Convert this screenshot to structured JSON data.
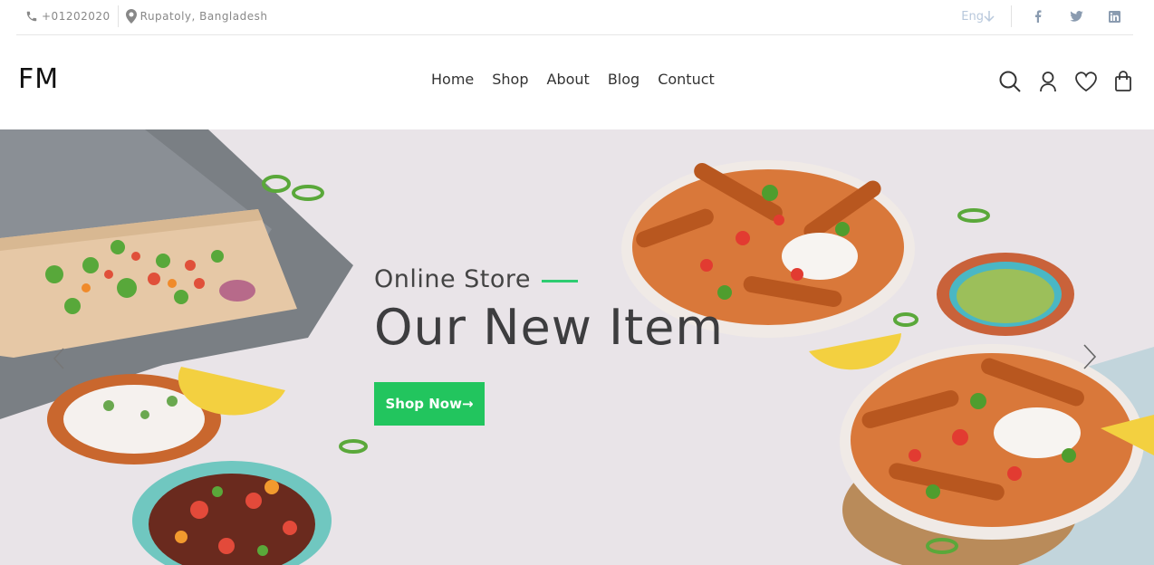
{
  "topbar": {
    "phone": "+01202020",
    "address": "Rupatoly, Bangladesh",
    "language": "Eng"
  },
  "header": {
    "logo": "FM",
    "nav": [
      {
        "label": "Home"
      },
      {
        "label": "Shop"
      },
      {
        "label": "About"
      },
      {
        "label": "Blog"
      },
      {
        "label": "Contuct"
      }
    ]
  },
  "hero": {
    "subtitle": "Online Store",
    "title": "Our New Item",
    "button_label": "Shop Now",
    "button_arrow": "→"
  },
  "colors": {
    "accent": "#22c55e",
    "hero_bg": "#e9e4e8"
  },
  "icons": [
    "phone-icon",
    "location-icon",
    "arrow-down-icon",
    "facebook-icon",
    "twitter-icon",
    "linkedin-icon",
    "search-icon",
    "user-icon",
    "heart-icon",
    "bag-icon",
    "chevron-left-icon",
    "chevron-right-icon"
  ]
}
